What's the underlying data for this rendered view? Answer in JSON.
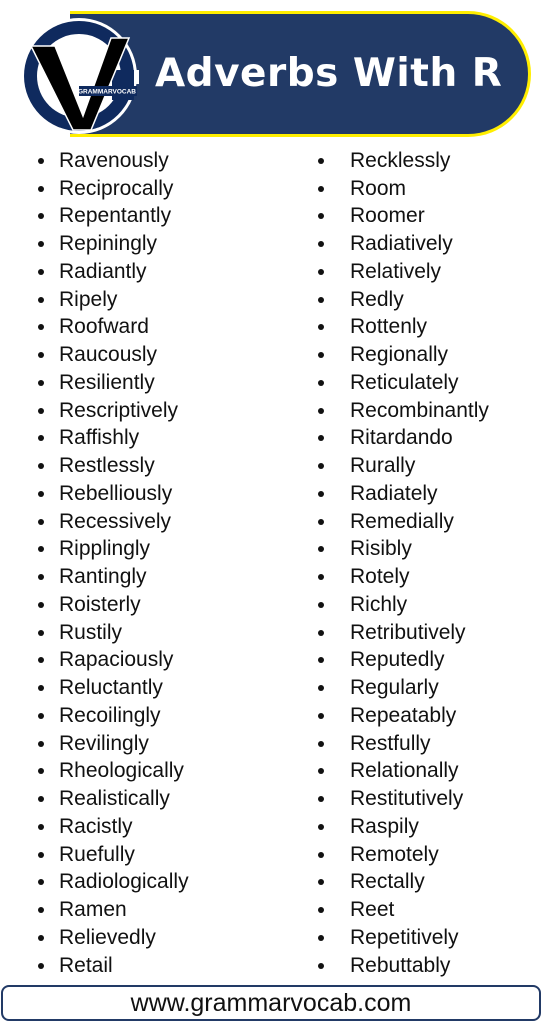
{
  "header": {
    "title": "Adverbs With R",
    "logo_text": "GRAMMARVOCAB",
    "colors": {
      "banner": "#223a66",
      "border": "#ffee00",
      "title": "#ffffff"
    }
  },
  "left_column": [
    "Ravenously",
    "Reciprocally",
    "Repentantly",
    "Repiningly",
    "Radiantly",
    "Ripely",
    "Roofward",
    "Raucously",
    "Resiliently",
    "Rescriptively",
    "Raffishly",
    "Restlessly",
    "Rebelliously",
    "Recessively",
    "Ripplingly",
    "Rantingly",
    "Roisterly",
    "Rustily",
    "Rapaciously",
    "Reluctantly",
    "Recoilingly",
    "Revilingly",
    "Rheologically",
    "Realistically",
    "Racistly",
    "Ruefully",
    "Radiologically",
    "Ramen",
    "Relievedly",
    "Retail"
  ],
  "right_column": [
    "Recklessly",
    "Room",
    "Roomer",
    "Radiatively",
    "Relatively",
    "Redly",
    "Rottenly",
    "Regionally",
    "Reticulately",
    "Recombinantly",
    "Ritardando",
    "Rurally",
    "Radiately",
    "Remedially",
    "Risibly",
    "Rotely",
    "Richly",
    "Retributively",
    "Reputedly",
    "Regularly",
    "Repeatably",
    "Restfully",
    "Relationally",
    "Restitutively",
    "Raspily",
    "Remotely",
    "Rectally",
    "Reet",
    "Repetitively",
    "Rebuttably"
  ],
  "footer": {
    "url": "www.grammarvocab.com"
  }
}
